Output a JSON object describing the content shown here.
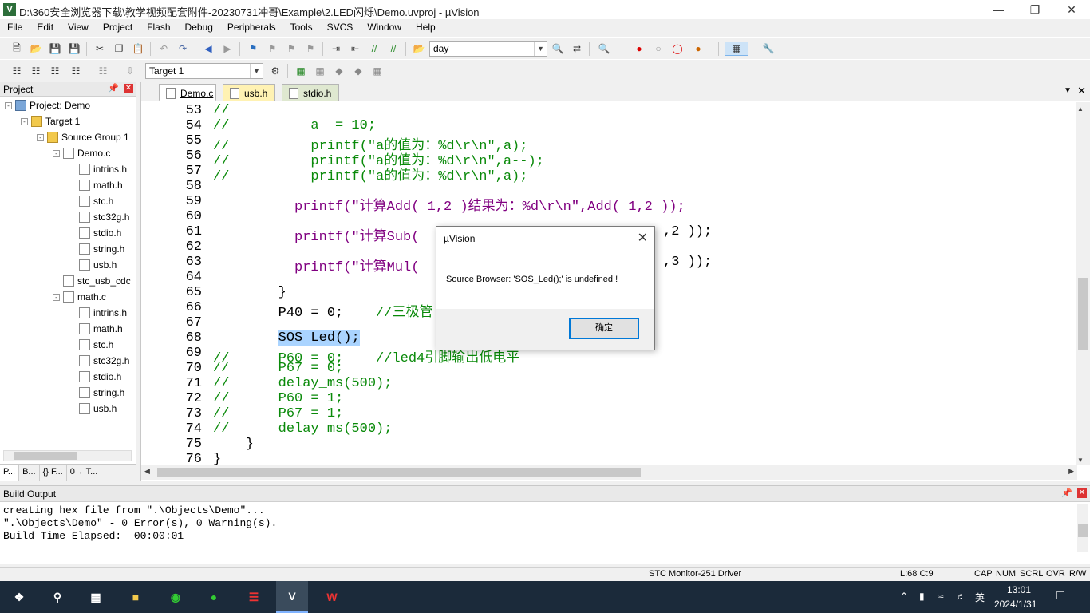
{
  "window": {
    "title": "D:\\360安全浏览器下载\\教学视频配套附件-20230731冲哥\\Example\\2.LED闪烁\\Demo.uvproj - µVision",
    "app_icon": "V"
  },
  "menu": [
    "File",
    "Edit",
    "View",
    "Project",
    "Flash",
    "Debug",
    "Peripherals",
    "Tools",
    "SVCS",
    "Window",
    "Help"
  ],
  "toolbar": {
    "find_value": "day",
    "target_value": "Target 1"
  },
  "project_panel": {
    "title": "Project",
    "tree": [
      {
        "label": "Project: Demo",
        "kind": "proj",
        "indent": 0,
        "expander": "-"
      },
      {
        "label": "Target 1",
        "kind": "folder",
        "indent": 1,
        "expander": "-"
      },
      {
        "label": "Source Group 1",
        "kind": "folder",
        "indent": 2,
        "expander": "-"
      },
      {
        "label": "Demo.c",
        "kind": "file",
        "indent": 3,
        "expander": "-"
      },
      {
        "label": "intrins.h",
        "kind": "file",
        "indent": 4,
        "expander": ""
      },
      {
        "label": "math.h",
        "kind": "file",
        "indent": 4,
        "expander": ""
      },
      {
        "label": "stc.h",
        "kind": "file",
        "indent": 4,
        "expander": ""
      },
      {
        "label": "stc32g.h",
        "kind": "file",
        "indent": 4,
        "expander": ""
      },
      {
        "label": "stdio.h",
        "kind": "file",
        "indent": 4,
        "expander": ""
      },
      {
        "label": "string.h",
        "kind": "file",
        "indent": 4,
        "expander": ""
      },
      {
        "label": "usb.h",
        "kind": "file",
        "indent": 4,
        "expander": ""
      },
      {
        "label": "stc_usb_cdc",
        "kind": "file",
        "indent": 3,
        "expander": ""
      },
      {
        "label": "math.c",
        "kind": "file",
        "indent": 3,
        "expander": "-"
      },
      {
        "label": "intrins.h",
        "kind": "file",
        "indent": 4,
        "expander": ""
      },
      {
        "label": "math.h",
        "kind": "file",
        "indent": 4,
        "expander": ""
      },
      {
        "label": "stc.h",
        "kind": "file",
        "indent": 4,
        "expander": ""
      },
      {
        "label": "stc32g.h",
        "kind": "file",
        "indent": 4,
        "expander": ""
      },
      {
        "label": "stdio.h",
        "kind": "file",
        "indent": 4,
        "expander": ""
      },
      {
        "label": "string.h",
        "kind": "file",
        "indent": 4,
        "expander": ""
      },
      {
        "label": "usb.h",
        "kind": "file",
        "indent": 4,
        "expander": ""
      }
    ],
    "tabs": [
      "P...",
      "B...",
      "{} F...",
      "0→ T..."
    ]
  },
  "editor": {
    "tabs": [
      {
        "label": "Demo.c",
        "active": true
      },
      {
        "label": "usb.h",
        "active": false
      },
      {
        "label": "stdio.h",
        "active": false
      }
    ],
    "lines": [
      {
        "n": "53",
        "code": "//",
        "type": "cm"
      },
      {
        "n": "54",
        "code": "//          a  = 10;",
        "type": "cm"
      },
      {
        "n": "55",
        "code": "//          printf(\"a的值为：%d\\r\\n\",a);",
        "type": "cm"
      },
      {
        "n": "56",
        "code": "//          printf(\"a的值为：%d\\r\\n\",a--);",
        "type": "cm"
      },
      {
        "n": "57",
        "code": "//          printf(\"a的值为：%d\\r\\n\",a);",
        "type": "cm"
      },
      {
        "n": "58",
        "code": "",
        "type": "plain"
      },
      {
        "n": "59",
        "code": "printf(\"计算Add( 1,2 )结果为：%d\\r\\n\",Add( 1,2 ));",
        "type": "call",
        "indent": 10
      },
      {
        "n": "60",
        "code": "",
        "type": "plain"
      },
      {
        "n": "61",
        "code": "printf(\"计算Sub(",
        "tail": ",2 ));",
        "type": "call2",
        "indent": 10
      },
      {
        "n": "62",
        "code": "",
        "type": "plain"
      },
      {
        "n": "63",
        "code": "printf(\"计算Mul(",
        "tail": ",3 ));",
        "type": "call2",
        "indent": 10
      },
      {
        "n": "64",
        "code": "",
        "type": "plain"
      },
      {
        "n": "65",
        "code": "        }",
        "type": "plain"
      },
      {
        "n": "66",
        "code": "        P40 = 0;    ",
        "comment": "//三极管",
        "type": "mixed"
      },
      {
        "n": "67",
        "code": "",
        "type": "plain"
      },
      {
        "n": "68",
        "code": "SOS_Led();",
        "type": "hl",
        "indent": 8
      },
      {
        "n": "69",
        "code": "//      P60 = 0;    //led4引脚输出低电平",
        "type": "cm"
      },
      {
        "n": "70",
        "code": "//      P67 = 0;",
        "type": "cm"
      },
      {
        "n": "71",
        "code": "//      delay_ms(500);",
        "type": "cm"
      },
      {
        "n": "72",
        "code": "//      P60 = 1;",
        "type": "cm"
      },
      {
        "n": "73",
        "code": "//      P67 = 1;",
        "type": "cm"
      },
      {
        "n": "74",
        "code": "//      delay_ms(500);",
        "type": "cm"
      },
      {
        "n": "75",
        "code": "    }",
        "type": "plain"
      },
      {
        "n": "76",
        "code": "}",
        "type": "plain"
      }
    ]
  },
  "dialog": {
    "title": "µVision",
    "message": "Source Browser: 'SOS_Led();' is undefined !",
    "ok_label": "确定"
  },
  "build_output": {
    "title": "Build Output",
    "lines": [
      "creating hex file from \".\\Objects\\Demo\"...",
      "\".\\Objects\\Demo\" - 0 Error(s), 0 Warning(s).",
      "Build Time Elapsed:  00:00:01"
    ]
  },
  "status": {
    "driver": "STC Monitor-251 Driver",
    "position": "L:68 C:9",
    "caps": "CAP",
    "num": "NUM",
    "scrl": "SCRL",
    "ovr": "OVR",
    "rw": "R/W"
  },
  "taskbar": {
    "ime": "英",
    "time": "13:01",
    "date": "2024/1/31"
  }
}
